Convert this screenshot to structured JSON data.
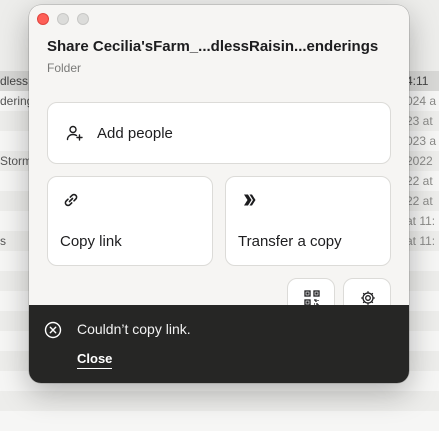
{
  "background_list": {
    "rows": [
      {
        "left": "dless",
        "right": "4:11",
        "selected": true
      },
      {
        "left": "dering",
        "right": "024 a",
        "selected": false
      },
      {
        "left": "",
        "right": "23 at",
        "selected": false
      },
      {
        "left": "",
        "right": "023 a",
        "selected": false
      },
      {
        "left": "Storm",
        "right": "2022",
        "selected": false
      },
      {
        "left": "",
        "right": "22 at",
        "selected": false
      },
      {
        "left": "",
        "right": "22 at",
        "selected": false
      },
      {
        "left": "",
        "right": "at 11:",
        "selected": false
      },
      {
        "left": "s",
        "right": "at 11:",
        "selected": false
      }
    ]
  },
  "dialog": {
    "title": "Share Cecilia'sFarm_...dlessRaisin...enderings",
    "subtitle": "Folder",
    "add_people_label": "Add people",
    "copy_link_label": "Copy link",
    "transfer_label": "Transfer a copy"
  },
  "toast": {
    "message": "Couldn’t copy link.",
    "close_label": "Close"
  },
  "colors": {
    "toast_bg": "#262625",
    "close_light": "#fe5f57",
    "dialog_bg": "#f6f5f3"
  },
  "icons": {
    "add_people": "person-plus-icon",
    "copy_link": "link-icon",
    "transfer": "transfer-logo-icon",
    "qr": "qr-code-icon",
    "settings": "gear-icon",
    "toast_error": "x-circle-icon"
  }
}
